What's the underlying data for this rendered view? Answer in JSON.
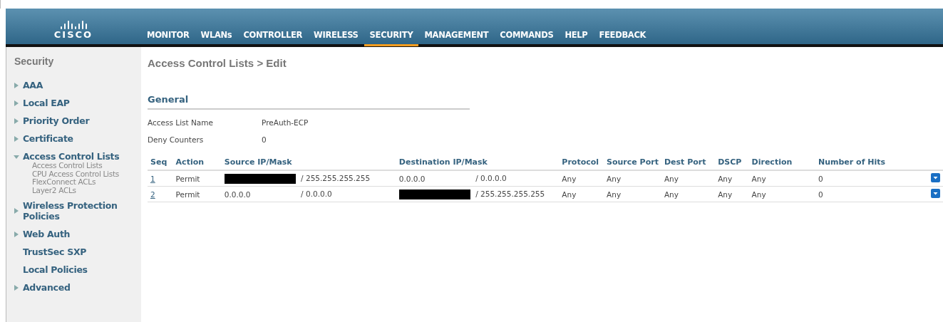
{
  "logo": {
    "text": "CISCO"
  },
  "menu": [
    {
      "label": "MONITOR",
      "selected": false
    },
    {
      "label": "WLANs",
      "selected": false
    },
    {
      "label": "CONTROLLER",
      "selected": false
    },
    {
      "label": "WIRELESS",
      "selected": false
    },
    {
      "label": "SECURITY",
      "selected": true
    },
    {
      "label": "MANAGEMENT",
      "selected": false
    },
    {
      "label": "COMMANDS",
      "selected": false
    },
    {
      "label": "HELP",
      "selected": false
    },
    {
      "label": "FEEDBACK",
      "selected": false
    }
  ],
  "sidebar": {
    "title": "Security",
    "items": [
      {
        "label": "AAA",
        "kind": "folder",
        "expanded": false
      },
      {
        "label": "Local EAP",
        "kind": "folder",
        "expanded": false
      },
      {
        "label": "Priority Order",
        "kind": "folder",
        "expanded": false
      },
      {
        "label": "Certificate",
        "kind": "folder",
        "expanded": false
      },
      {
        "label": "Access Control Lists",
        "kind": "folder",
        "expanded": true,
        "children": [
          {
            "label": "Access Control Lists"
          },
          {
            "label": "CPU Access Control Lists"
          },
          {
            "label": "FlexConnect ACLs"
          },
          {
            "label": "Layer2 ACLs"
          }
        ]
      },
      {
        "label": "Wireless Protection Policies",
        "kind": "folder",
        "expanded": false
      },
      {
        "label": "Web Auth",
        "kind": "folder",
        "expanded": false
      },
      {
        "label": "TrustSec SXP",
        "kind": "link"
      },
      {
        "label": "Local Policies",
        "kind": "link"
      },
      {
        "label": "Advanced",
        "kind": "folder",
        "expanded": false
      }
    ]
  },
  "page_title": "Access Control Lists > Edit",
  "general": {
    "heading": "General",
    "fields": [
      {
        "label": "Access List Name",
        "value": "PreAuth-ECP"
      },
      {
        "label": "Deny Counters",
        "value": "0"
      }
    ]
  },
  "table": {
    "columns": [
      "Seq",
      "Action",
      "Source IP/Mask",
      "Destination IP/Mask",
      "Protocol",
      "Source Port",
      "Dest Port",
      "DSCP",
      "Direction",
      "Number of Hits"
    ],
    "rows": [
      {
        "seq": "1",
        "action": "Permit",
        "source": {
          "redacted": true,
          "mask": "/ 255.255.255.255"
        },
        "destination": {
          "redacted": false,
          "ip": "0.0.0.0",
          "mask": "/ 0.0.0.0"
        },
        "protocol": "Any",
        "source_port": "Any",
        "dest_port": "Any",
        "dscp": "Any",
        "direction": "Any",
        "hits": "0"
      },
      {
        "seq": "2",
        "action": "Permit",
        "source": {
          "redacted": false,
          "ip": "0.0.0.0",
          "mask": "/ 0.0.0.0"
        },
        "destination": {
          "redacted": true,
          "mask": "/ 255.255.255.255"
        },
        "protocol": "Any",
        "source_port": "Any",
        "dest_port": "Any",
        "dscp": "Any",
        "direction": "Any",
        "hits": "0"
      }
    ]
  }
}
